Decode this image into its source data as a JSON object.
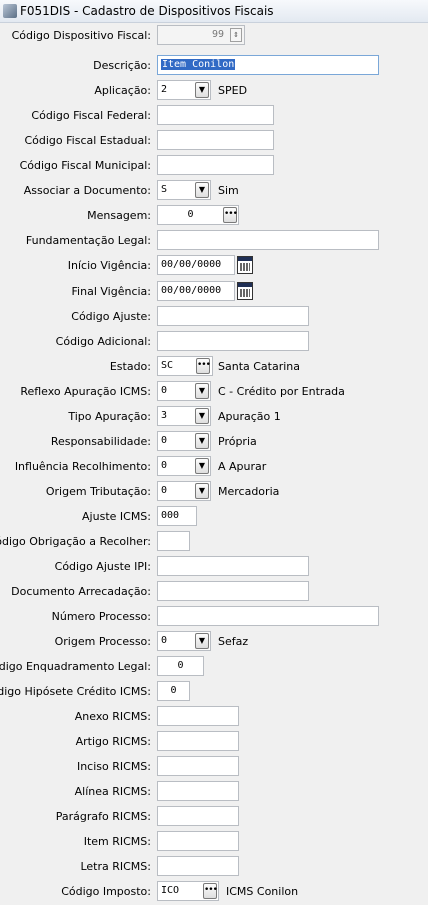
{
  "window": {
    "title": "F051DIS - Cadastro de Dispositivos Fiscais"
  },
  "form": {
    "codigo_dispositivo": {
      "label": "Código Dispositivo Fiscal:",
      "value": "99"
    },
    "descricao": {
      "label": "Descrição:",
      "value": "Item Conilon"
    },
    "aplicacao": {
      "label": "Aplicação:",
      "value": "2",
      "desc": "SPED"
    },
    "cod_fiscal_federal": {
      "label": "Código Fiscal Federal:",
      "value": ""
    },
    "cod_fiscal_estadual": {
      "label": "Código Fiscal Estadual:",
      "value": ""
    },
    "cod_fiscal_municipal": {
      "label": "Código Fiscal Municipal:",
      "value": ""
    },
    "associar_documento": {
      "label": "Associar a Documento:",
      "value": "S",
      "desc": "Sim"
    },
    "mensagem": {
      "label": "Mensagem:",
      "value": "0"
    },
    "fundamentacao_legal": {
      "label": "Fundamentação Legal:",
      "value": ""
    },
    "inicio_vigencia": {
      "label": "Início Vigência:",
      "value": "00/00/0000"
    },
    "final_vigencia": {
      "label": "Final Vigência:",
      "value": "00/00/0000"
    },
    "codigo_ajuste": {
      "label": "Código Ajuste:",
      "value": ""
    },
    "codigo_adicional": {
      "label": "Código Adicional:",
      "value": ""
    },
    "estado": {
      "label": "Estado:",
      "value": "SC",
      "desc": "Santa Catarina"
    },
    "reflexo_apuracao": {
      "label": "Reflexo Apuração ICMS:",
      "value": "0",
      "desc": "C - Crédito por Entrada"
    },
    "tipo_apuracao": {
      "label": "Tipo Apuração:",
      "value": "3",
      "desc": "Apuração 1"
    },
    "responsabilidade": {
      "label": "Responsabilidade:",
      "value": "0",
      "desc": "Própria"
    },
    "influencia_recolhimento": {
      "label": "Influência Recolhimento:",
      "value": "0",
      "desc": "A Apurar"
    },
    "origem_tributacao": {
      "label": "Origem Tributação:",
      "value": "0",
      "desc": "Mercadoria"
    },
    "ajuste_icms": {
      "label": "Ajuste ICMS:",
      "value": "000"
    },
    "cod_obrigacao_recolher": {
      "label": "Código Obrigação a Recolher:",
      "value": ""
    },
    "cod_ajuste_ipi": {
      "label": "Código Ajuste IPI:",
      "value": ""
    },
    "documento_arrecadacao": {
      "label": "Documento Arrecadação:",
      "value": ""
    },
    "numero_processo": {
      "label": "Número Processo:",
      "value": ""
    },
    "origem_processo": {
      "label": "Origem Processo:",
      "value": "0",
      "desc": "Sefaz"
    },
    "cod_enquadramento_legal": {
      "label": "Código Enquadramento Legal:",
      "value": "0"
    },
    "cod_hipotese_credito": {
      "label": "Código Hipósete Crédito ICMS:",
      "value": "0"
    },
    "anexo_ricms": {
      "label": "Anexo RICMS:",
      "value": ""
    },
    "artigo_ricms": {
      "label": "Artigo RICMS:",
      "value": ""
    },
    "inciso_ricms": {
      "label": "Inciso RICMS:",
      "value": ""
    },
    "alinea_ricms": {
      "label": "Alínea RICMS:",
      "value": ""
    },
    "paragrafo_ricms": {
      "label": "Parágrafo RICMS:",
      "value": ""
    },
    "item_ricms": {
      "label": "Item RICMS:",
      "value": ""
    },
    "letra_ricms": {
      "label": "Letra RICMS:",
      "value": ""
    },
    "codigo_imposto": {
      "label": "Código Imposto:",
      "value": "ICO",
      "desc": "ICMS Conilon"
    }
  },
  "icons": {
    "dropdown": "chevron-down-icon",
    "lookup": "ellipsis-icon",
    "calendar": "calendar-icon",
    "spinner": "spinner-icon"
  }
}
